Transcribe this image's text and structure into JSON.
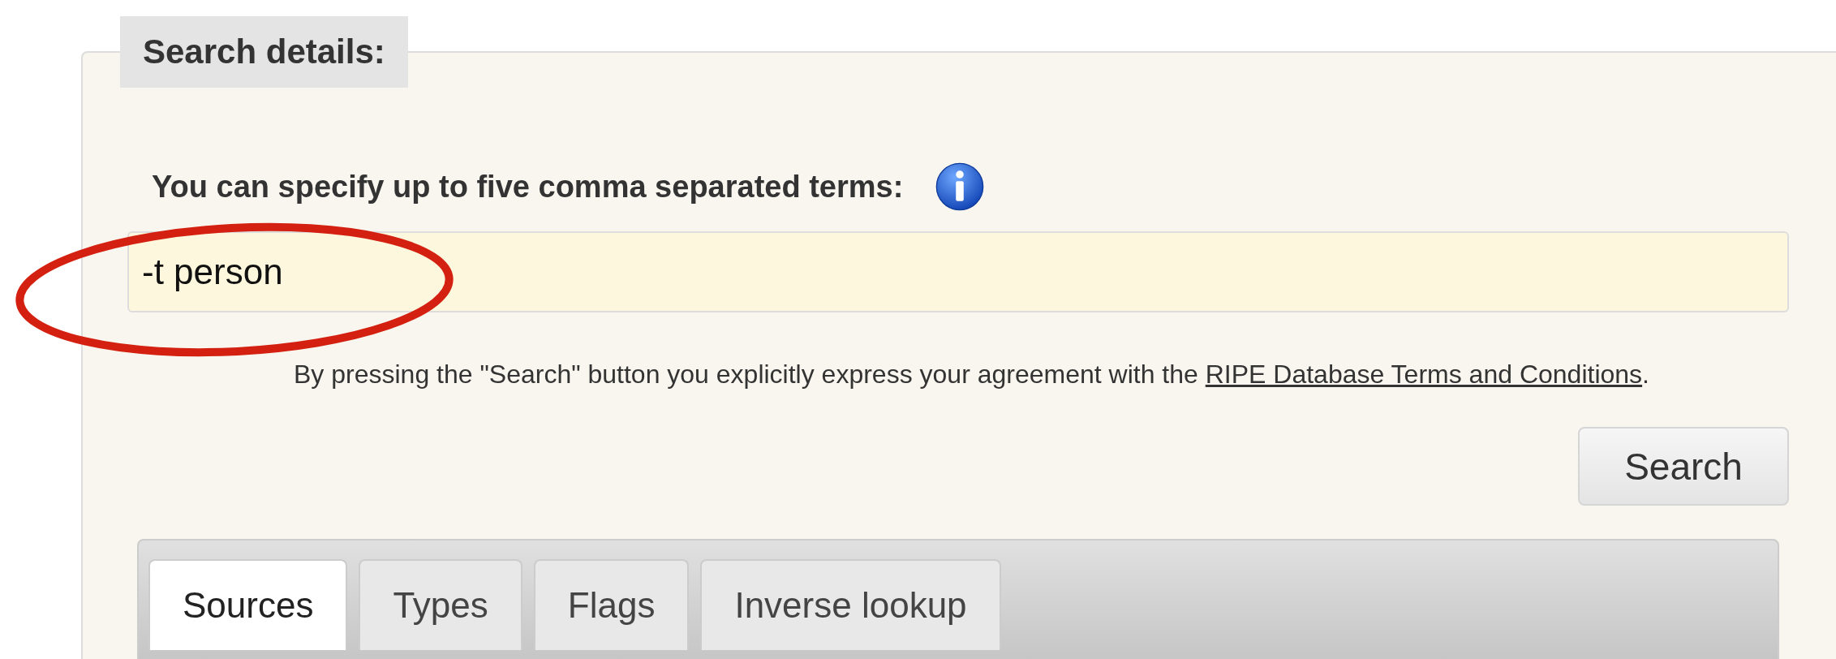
{
  "panel": {
    "legend": "Search details:"
  },
  "query": {
    "label": "You can specify up to five comma separated terms:",
    "value": "-t person"
  },
  "terms_notice": {
    "before": "By pressing the \"Search\" button you explicitly express your agreement with the ",
    "link": "RIPE Database Terms and Conditions",
    "after": "."
  },
  "search_button": "Search",
  "tabs": [
    {
      "label": "Sources",
      "selected": true
    },
    {
      "label": "Types",
      "selected": false
    },
    {
      "label": "Flags",
      "selected": false
    },
    {
      "label": "Inverse lookup",
      "selected": false
    }
  ]
}
